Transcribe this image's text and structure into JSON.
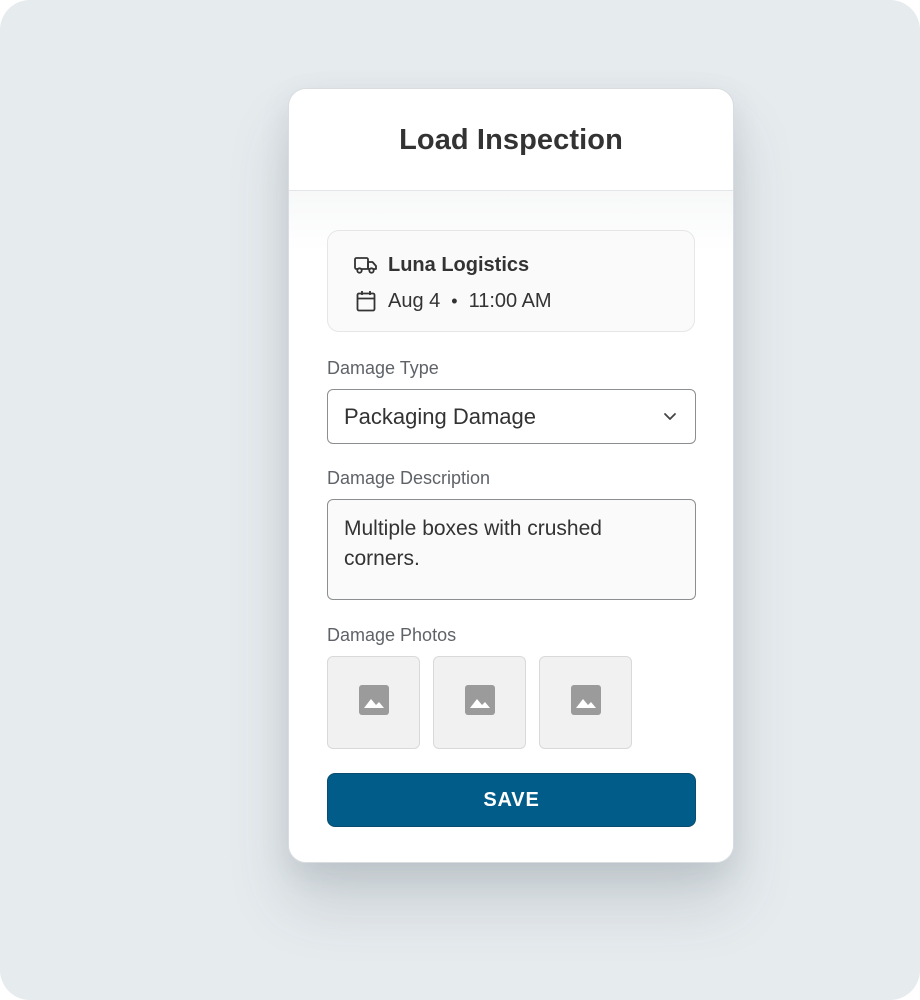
{
  "header": {
    "title": "Load Inspection"
  },
  "shipment": {
    "carrier_icon": "truck-icon",
    "carrier": "Luna Logistics",
    "date_icon": "calendar-icon",
    "date": "Aug 4",
    "separator": "•",
    "time": "11:00 AM"
  },
  "damage_type": {
    "label": "Damage Type",
    "value": "Packaging Damage",
    "icon": "chevron-down-icon"
  },
  "damage_description": {
    "label": "Damage Description",
    "value": "Multiple boxes with crushed corners."
  },
  "damage_photos": {
    "label": "Damage Photos",
    "slot_icon": "image-placeholder-icon",
    "slots": 3
  },
  "actions": {
    "save_label": "SAVE"
  },
  "colors": {
    "background": "#e6ebee",
    "primary_button": "#015c8a",
    "card": "#ffffff"
  }
}
